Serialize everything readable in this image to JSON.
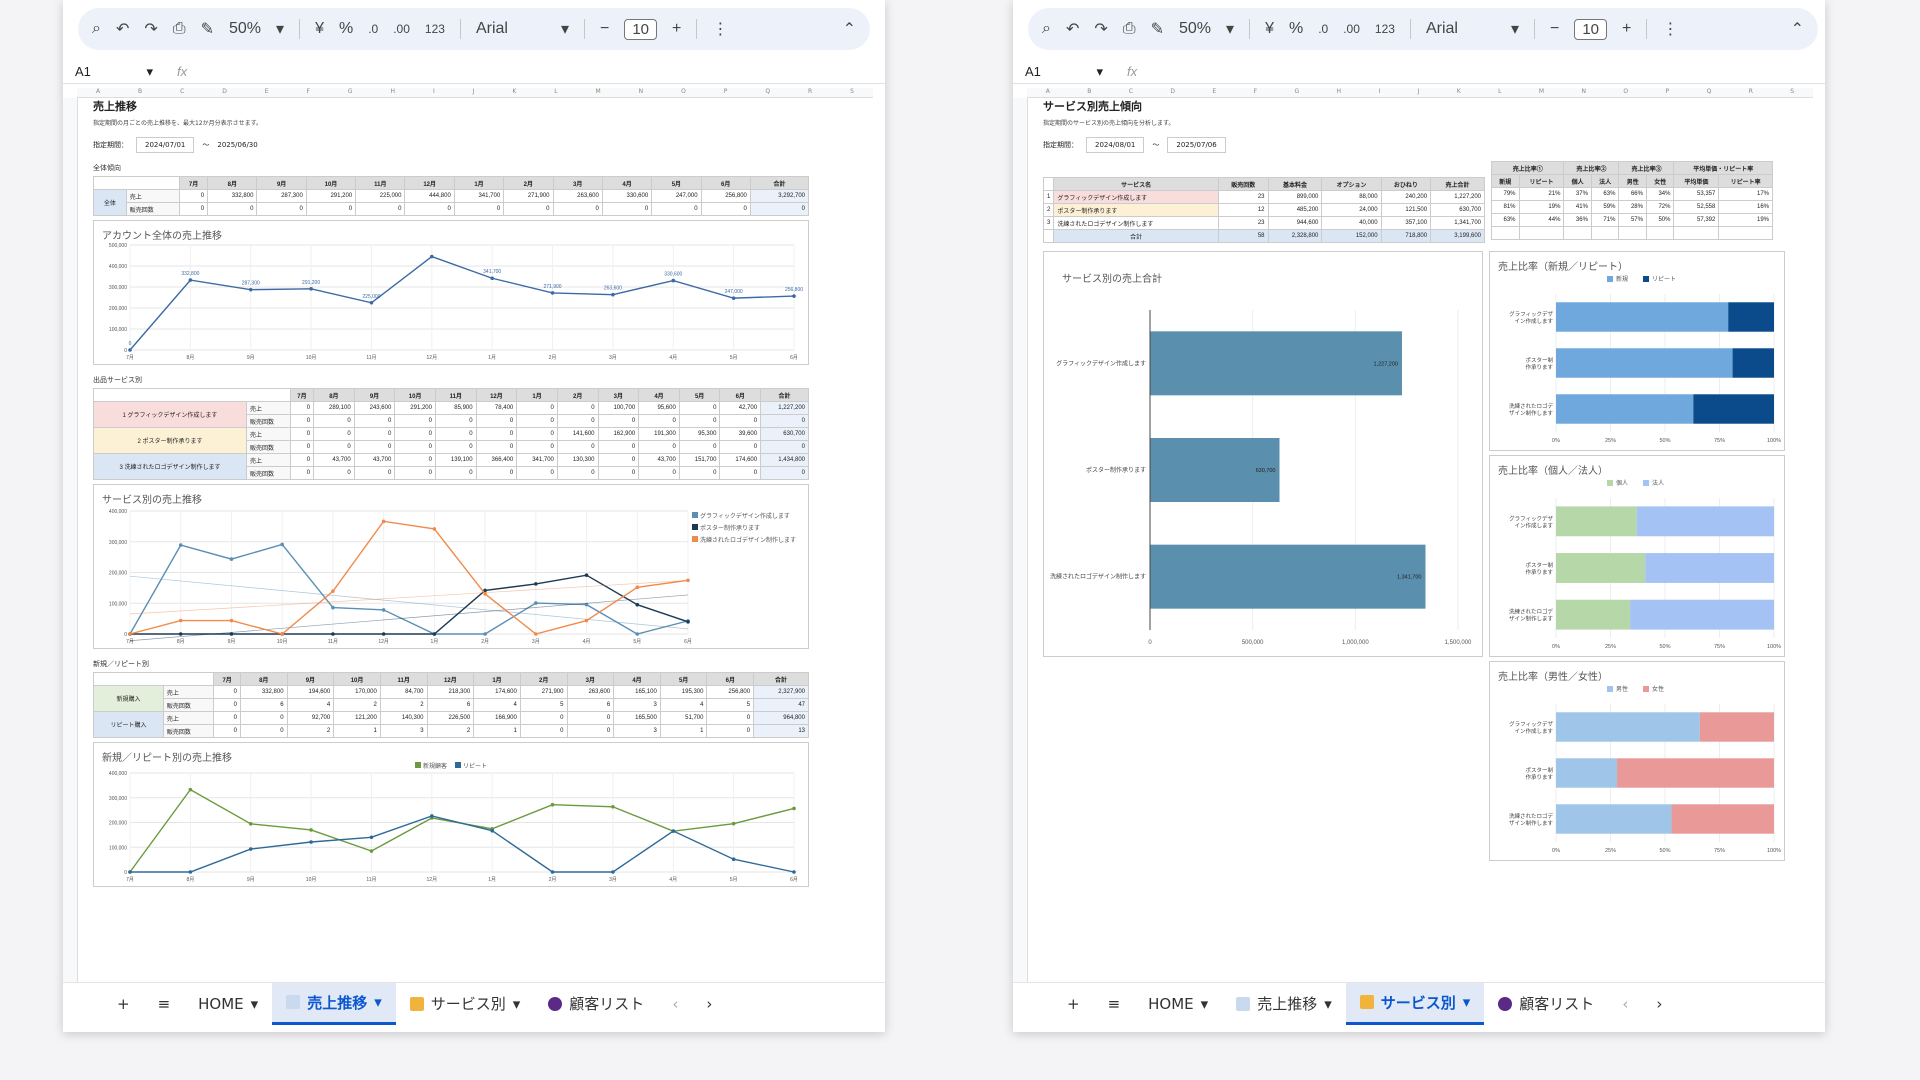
{
  "toolbar": {
    "zoom": "50%",
    "currency": "¥",
    "percent": "%",
    "dec_dec": ".0",
    "dec_inc": ".00",
    "num_fmt": "123",
    "font": "Arial",
    "font_size": "10"
  },
  "formula_bar": {
    "name_box": "A1",
    "fx": "fx"
  },
  "col_letters": [
    "A",
    "B",
    "C",
    "D",
    "E",
    "F",
    "G",
    "H",
    "I",
    "J",
    "K",
    "L",
    "M",
    "N",
    "O",
    "P",
    "Q",
    "R",
    "S"
  ],
  "sheet1": {
    "title": "売上推移",
    "subtitle": "指定期間の月ごとの売上推移を、最大12か月分表示させます。",
    "period_label": "指定期間：",
    "period_from": "2024/07/01",
    "period_sep": "〜",
    "period_to": "2025/06/30",
    "months": [
      "7月",
      "8月",
      "9月",
      "10月",
      "11月",
      "12月",
      "1月",
      "2月",
      "3月",
      "4月",
      "5月",
      "6月",
      "合計"
    ],
    "section_total": "全体傾向",
    "total_name": "全体",
    "row_sales": "売上",
    "row_count": "販売回数",
    "total_sales": [
      "0",
      "332,800",
      "287,300",
      "291,200",
      "225,000",
      "444,800",
      "341,700",
      "271,900",
      "263,600",
      "330,600",
      "247,000",
      "256,800",
      "3,292,700"
    ],
    "total_count": [
      "0",
      "0",
      "0",
      "0",
      "0",
      "0",
      "0",
      "0",
      "0",
      "0",
      "0",
      "0",
      "0"
    ],
    "section_service": "出品サービス別",
    "services": [
      {
        "no": "1",
        "name": "グラフィックデザイン作成します",
        "sales": [
          "0",
          "289,100",
          "243,600",
          "291,200",
          "85,900",
          "78,400",
          "0",
          "0",
          "100,700",
          "95,600",
          "0",
          "42,700",
          "1,227,200"
        ],
        "count": [
          "0",
          "0",
          "0",
          "0",
          "0",
          "0",
          "0",
          "0",
          "0",
          "0",
          "0",
          "0",
          "0"
        ]
      },
      {
        "no": "2",
        "name": "ポスター制作承ります",
        "sales": [
          "0",
          "0",
          "0",
          "0",
          "0",
          "0",
          "0",
          "141,600",
          "162,900",
          "191,300",
          "95,300",
          "39,600",
          "630,700"
        ],
        "count": [
          "0",
          "0",
          "0",
          "0",
          "0",
          "0",
          "0",
          "0",
          "0",
          "0",
          "0",
          "0",
          "0"
        ]
      },
      {
        "no": "3",
        "name": "洗練されたロゴデザイン制作します",
        "sales": [
          "0",
          "43,700",
          "43,700",
          "0",
          "139,100",
          "366,400",
          "341,700",
          "130,300",
          "0",
          "43,700",
          "151,700",
          "174,600",
          "1,434,800"
        ],
        "count": [
          "0",
          "0",
          "0",
          "0",
          "0",
          "0",
          "0",
          "0",
          "0",
          "0",
          "0",
          "0",
          "0"
        ]
      }
    ],
    "section_newrep": "新規／リピート別",
    "newrep": [
      {
        "name": "新規購入",
        "sales": [
          "0",
          "332,800",
          "194,600",
          "170,000",
          "84,700",
          "218,300",
          "174,600",
          "271,900",
          "263,600",
          "165,100",
          "195,300",
          "256,800",
          "2,327,900"
        ],
        "count": [
          "0",
          "6",
          "4",
          "2",
          "2",
          "6",
          "4",
          "5",
          "6",
          "3",
          "4",
          "5",
          "47"
        ]
      },
      {
        "name": "リピート購入",
        "sales": [
          "0",
          "0",
          "92,700",
          "121,200",
          "140,300",
          "226,500",
          "166,900",
          "0",
          "0",
          "165,500",
          "51,700",
          "0",
          "964,800"
        ],
        "count": [
          "0",
          "0",
          "2",
          "1",
          "3",
          "2",
          "1",
          "0",
          "0",
          "3",
          "1",
          "0",
          "13"
        ]
      }
    ]
  },
  "chart_data": [
    {
      "type": "line",
      "title": "アカウント全体の売上推移",
      "categories": [
        "7月",
        "8月",
        "9月",
        "10月",
        "11月",
        "12月",
        "1月",
        "2月",
        "3月",
        "4月",
        "5月",
        "6月"
      ],
      "series": [
        {
          "values": [
            0,
            332800,
            287300,
            291200,
            225000,
            444800,
            341700,
            271900,
            263600,
            330600,
            247000,
            256800
          ]
        }
      ],
      "data_labels": [
        "0",
        "332,800",
        "287,300",
        "291,200",
        "225,000",
        "",
        "341,700",
        "271,900",
        "263,600",
        "330,600",
        "247,000",
        "256,800"
      ],
      "ylim": [
        0,
        500000
      ],
      "yticks": [
        "0",
        "100,000",
        "200,000",
        "300,000",
        "400,000",
        "500,000"
      ],
      "color": "#3d6aa5"
    },
    {
      "type": "line",
      "title": "サービス別の売上推移",
      "categories": [
        "7月",
        "8月",
        "9月",
        "10月",
        "11月",
        "12月",
        "1月",
        "2月",
        "3月",
        "4月",
        "5月",
        "6月"
      ],
      "series": [
        {
          "name": "グラフィックデザイン作成します",
          "values": [
            0,
            289100,
            243600,
            291200,
            85900,
            78400,
            0,
            0,
            100700,
            95600,
            0,
            42700
          ],
          "color": "#5b8fb4"
        },
        {
          "name": "ポスター制作承ります",
          "values": [
            0,
            0,
            0,
            0,
            0,
            0,
            0,
            141600,
            162900,
            191300,
            95300,
            39600
          ],
          "color": "#1d3a55"
        },
        {
          "name": "洗練されたロゴデザイン制作します",
          "values": [
            0,
            43700,
            43700,
            0,
            139100,
            366400,
            341700,
            130300,
            0,
            43700,
            151700,
            174600
          ],
          "color": "#f08a4b"
        }
      ],
      "ylim": [
        0,
        400000
      ],
      "yticks": [
        "0",
        "100,000",
        "200,000",
        "300,000",
        "400,000"
      ]
    },
    {
      "type": "line",
      "title": "新規／リピート別の売上推移",
      "categories": [
        "7月",
        "8月",
        "9月",
        "10月",
        "11月",
        "12月",
        "1月",
        "2月",
        "3月",
        "4月",
        "5月",
        "6月"
      ],
      "series": [
        {
          "name": "新規顧客",
          "values": [
            0,
            332800,
            194600,
            170000,
            84700,
            218300,
            174600,
            271900,
            263600,
            165100,
            195300,
            256800
          ],
          "color": "#6a9a3c"
        },
        {
          "name": "リピート",
          "values": [
            0,
            0,
            92700,
            121200,
            140300,
            226500,
            166900,
            0,
            0,
            165500,
            51700,
            0
          ],
          "color": "#2e6a99"
        }
      ],
      "ylim": [
        0,
        400000
      ],
      "yticks": [
        "0",
        "100,000",
        "200,000",
        "300,000",
        "400,000"
      ]
    },
    {
      "type": "bar",
      "title": "サービス別の売上合計",
      "categories": [
        "グラフィックデザイン作成します",
        "ポスター制作承ります",
        "洗練されたロゴデザイン制作します"
      ],
      "values": [
        1227200,
        630700,
        1341700
      ],
      "value_labels": [
        "1,227,200",
        "630,700",
        "1,341,700"
      ],
      "xlim": [
        0,
        1500000
      ],
      "xticks": [
        "0",
        "500,000",
        "1,000,000",
        "1,500,000"
      ],
      "color": "#5a8fae"
    },
    {
      "type": "bar",
      "title": "売上比率（新規／リピート）",
      "categories": [
        "グラフィックデザイン作成します",
        "ポスター制作承ります",
        "洗練されたロゴデザイン制作します"
      ],
      "series": [
        {
          "name": "新規",
          "values": [
            79,
            81,
            63
          ],
          "color": "#6fa8dc"
        },
        {
          "name": "リピート",
          "values": [
            21,
            19,
            37
          ],
          "color": "#0b4a8b"
        }
      ],
      "xticks": [
        "0%",
        "25%",
        "50%",
        "75%",
        "100%"
      ]
    },
    {
      "type": "bar",
      "title": "売上比率（個人／法人）",
      "categories": [
        "グラフィックデザイン作成します",
        "ポスター制作承ります",
        "洗練されたロゴデザイン制作します"
      ],
      "series": [
        {
          "name": "個人",
          "values": [
            37,
            41,
            34
          ],
          "color": "#b6d7a8"
        },
        {
          "name": "法人",
          "values": [
            63,
            59,
            66
          ],
          "color": "#a4c2f4"
        }
      ],
      "xticks": [
        "0%",
        "25%",
        "50%",
        "75%",
        "100%"
      ]
    },
    {
      "type": "bar",
      "title": "売上比率（男性／女性）",
      "categories": [
        "グラフィックデザイン作成します",
        "ポスター制作承ります",
        "洗練されたロゴデザイン制作します"
      ],
      "series": [
        {
          "name": "男性",
          "values": [
            66,
            28,
            53
          ],
          "color": "#9fc5e8"
        },
        {
          "name": "女性",
          "values": [
            34,
            72,
            47
          ],
          "color": "#ea9999"
        }
      ],
      "xticks": [
        "0%",
        "25%",
        "50%",
        "75%",
        "100%"
      ]
    }
  ],
  "sheet2": {
    "title": "サービス別売上傾向",
    "subtitle": "指定期間のサービス別の売上傾向を分析します。",
    "period_label": "指定期間：",
    "period_from": "2024/08/01",
    "period_sep": "〜",
    "period_to": "2025/07/06",
    "headers": [
      "サービス名",
      "販売回数",
      "基本料金",
      "オプション",
      "おひねり",
      "売上合計"
    ],
    "rows": [
      {
        "no": "1",
        "name": "グラフィックデザイン作成します",
        "vals": [
          "23",
          "899,000",
          "88,000",
          "240,200",
          "1,227,200"
        ]
      },
      {
        "no": "2",
        "name": "ポスター制作承ります",
        "vals": [
          "12",
          "485,200",
          "24,000",
          "121,500",
          "630,700"
        ]
      },
      {
        "no": "3",
        "name": "洗練されたロゴデザイン制作します",
        "vals": [
          "23",
          "944,600",
          "40,000",
          "357,100",
          "1,341,700"
        ]
      }
    ],
    "total_label": "合計",
    "total_vals": [
      "58",
      "2,328,800",
      "152,000",
      "718,800",
      "3,199,600"
    ],
    "ratio_groups": [
      "売上比率①",
      "売上比率②",
      "売上比率③",
      "平均単価・リピート率"
    ],
    "ratio_heads": [
      "新規",
      "リピート",
      "個人",
      "法人",
      "男性",
      "女性",
      "平均単価",
      "リピート率"
    ],
    "ratio_rows": [
      [
        "79%",
        "21%",
        "37%",
        "63%",
        "66%",
        "34%",
        "53,357",
        "17%"
      ],
      [
        "81%",
        "19%",
        "41%",
        "59%",
        "28%",
        "72%",
        "52,558",
        "16%"
      ],
      [
        "63%",
        "44%",
        "36%",
        "71%",
        "57%",
        "50%",
        "57,392",
        "19%"
      ]
    ]
  },
  "tabs": {
    "add": "+",
    "list": "≡",
    "home": "HOME",
    "t1": "売上推移",
    "t2": "サービス別",
    "t3": "顧客リスト",
    "prev": "‹",
    "next": "›"
  }
}
